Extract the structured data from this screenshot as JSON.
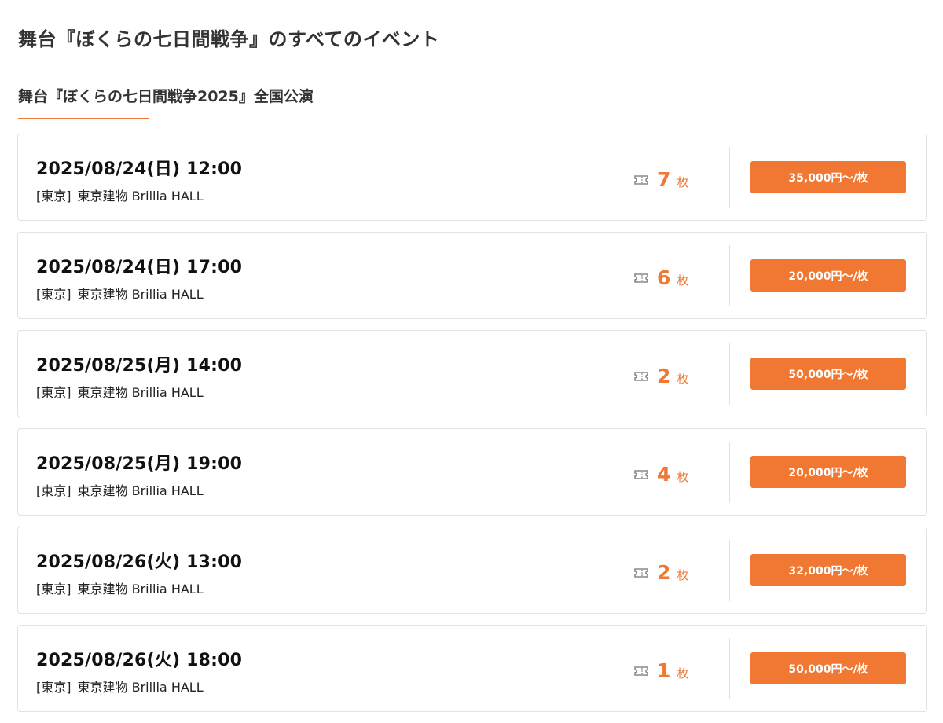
{
  "page": {
    "title": "舞台『ぼくらの七日間戦争』のすべてのイベント"
  },
  "section": {
    "title": "舞台『ぼくらの七日間戦争2025』全国公演"
  },
  "colors": {
    "accent": "#f07832",
    "border": "#e2e2e2",
    "icon": "#888888"
  },
  "events": [
    {
      "date": "2025/08/24(日) 12:00",
      "area": "[東京]",
      "venue": "東京建物 Brillia HALL",
      "stock": "7",
      "stock_unit": "枚",
      "price": "35,000円〜/枚",
      "icon": "ticket-icon"
    },
    {
      "date": "2025/08/24(日) 17:00",
      "area": "[東京]",
      "venue": "東京建物 Brillia HALL",
      "stock": "6",
      "stock_unit": "枚",
      "price": "20,000円〜/枚",
      "icon": "ticket-icon"
    },
    {
      "date": "2025/08/25(月) 14:00",
      "area": "[東京]",
      "venue": "東京建物 Brillia HALL",
      "stock": "2",
      "stock_unit": "枚",
      "price": "50,000円〜/枚",
      "icon": "ticket-icon"
    },
    {
      "date": "2025/08/25(月) 19:00",
      "area": "[東京]",
      "venue": "東京建物 Brillia HALL",
      "stock": "4",
      "stock_unit": "枚",
      "price": "20,000円〜/枚",
      "icon": "ticket-icon"
    },
    {
      "date": "2025/08/26(火) 13:00",
      "area": "[東京]",
      "venue": "東京建物 Brillia HALL",
      "stock": "2",
      "stock_unit": "枚",
      "price": "32,000円〜/枚",
      "icon": "ticket-icon"
    },
    {
      "date": "2025/08/26(火) 18:00",
      "area": "[東京]",
      "venue": "東京建物 Brillia HALL",
      "stock": "1",
      "stock_unit": "枚",
      "price": "50,000円〜/枚",
      "icon": "ticket-icon"
    }
  ]
}
